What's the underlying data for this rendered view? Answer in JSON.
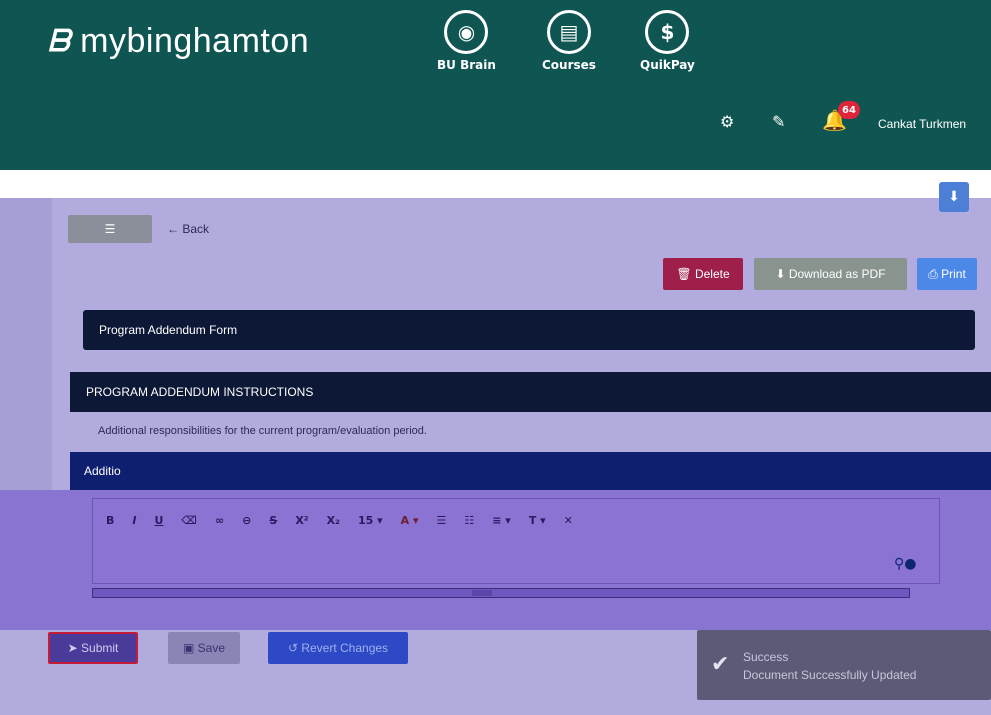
{
  "header": {
    "brand": "mybinghamton",
    "nav": [
      {
        "label": "BU Brain",
        "icon": "brain-icon"
      },
      {
        "label": "Courses",
        "icon": "book-icon"
      },
      {
        "label": "QuikPay",
        "icon": "lock-dollar-icon"
      }
    ],
    "notification_count": "64",
    "user_name": "Cankat Turkmen"
  },
  "toolbar_top": {
    "back_label": "Back"
  },
  "actions": {
    "delete": "Delete",
    "download": "Download as PDF",
    "print": "Print"
  },
  "form": {
    "title": "Program Addendum Form",
    "instructions_header": "PROGRAM ADDENDUM INSTRUCTIONS",
    "instructions_text": "Additional responsibilities for the current program/evaluation period.",
    "additional_header": "Additio"
  },
  "editor": {
    "font_size": "15"
  },
  "bottom": {
    "submit": "Submit",
    "save": "Save",
    "revert": "Revert Changes"
  },
  "toast": {
    "title": "Success",
    "message": "Document Successfully Updated"
  }
}
